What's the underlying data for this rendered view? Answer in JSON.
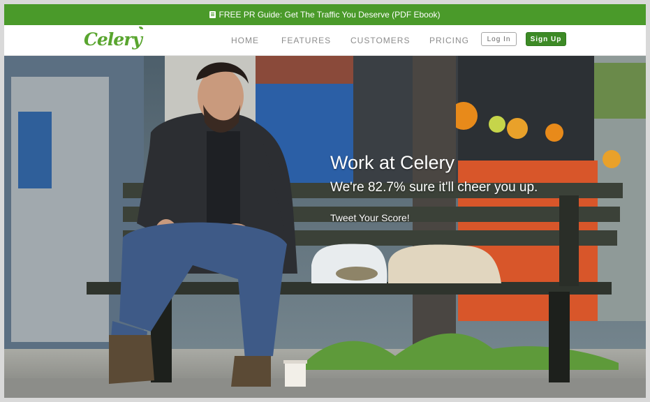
{
  "promo": {
    "icon": "book-icon",
    "text": "FREE PR Guide: Get The Traffic You Deserve (PDF Ebook)"
  },
  "brand": {
    "logo_text": "Celery",
    "accent": "#4a9a2a"
  },
  "nav": {
    "items": [
      {
        "label": "HOME"
      },
      {
        "label": "FEATURES"
      },
      {
        "label": "CUSTOMERS"
      },
      {
        "label": "PRICING"
      }
    ],
    "login_label": "Log In",
    "signup_label": "Sign Up"
  },
  "hero": {
    "title": "Work at Celery",
    "subtitle": "We're 82.7% sure it'll cheer you up.",
    "tweet_label": "Tweet Your Score!",
    "image": "man-sitting-on-park-bench-photo"
  }
}
